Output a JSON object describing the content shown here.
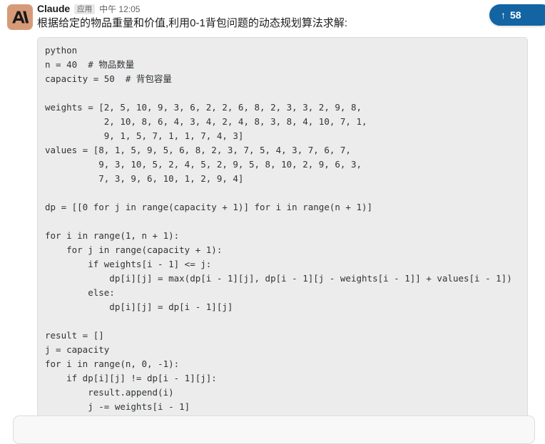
{
  "message": {
    "sender": "Claude",
    "app_badge": "应用",
    "timestamp": "中午 12:05",
    "text": "根据给定的物品重量和价值,利用0-1背包问题的动态规划算法求解:",
    "avatar_icon": "anthropic-logo-icon"
  },
  "code_block": {
    "language_label": "python",
    "content": "python\nn = 40  # 物品数量\ncapacity = 50  # 背包容量\n\nweights = [2, 5, 10, 9, 3, 6, 2, 2, 6, 8, 2, 3, 3, 2, 9, 8,\n           2, 10, 8, 6, 4, 3, 4, 2, 4, 8, 3, 8, 4, 10, 7, 1,\n           9, 1, 5, 7, 1, 1, 7, 4, 3]\nvalues = [8, 1, 5, 9, 5, 6, 8, 2, 3, 7, 5, 4, 3, 7, 6, 7,\n          9, 3, 10, 5, 2, 4, 5, 2, 9, 5, 8, 10, 2, 9, 6, 3,\n          7, 3, 9, 6, 10, 1, 2, 9, 4]\n\ndp = [[0 for j in range(capacity + 1)] for i in range(n + 1)]\n\nfor i in range(1, n + 1):\n    for j in range(capacity + 1):\n        if weights[i - 1] <= j:\n            dp[i][j] = max(dp[i - 1][j], dp[i - 1][j - weights[i - 1]] + values[i - 1])\n        else:\n            dp[i][j] = dp[i - 1][j]\n\nresult = []\nj = capacity\nfor i in range(n, 0, -1):\n    if dp[i][j] != dp[i - 1][j]:\n        result.append(i)\n        j -= weights[i - 1]"
  },
  "unread_pill": {
    "arrow": "↑",
    "count": "58"
  },
  "colors": {
    "accent_blue": "#1264A3",
    "avatar_bg": "#D79A78",
    "code_bg": "#ececec",
    "text": "#1d1c1d",
    "muted_text": "#616061"
  }
}
